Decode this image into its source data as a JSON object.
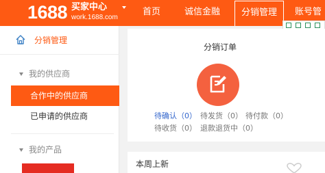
{
  "header": {
    "logo_num": "1688",
    "logo_title": "买家中心",
    "logo_url": "work.1688.com",
    "nav": {
      "home": "首页",
      "credit": "诚信金融",
      "distribution": "分销管理",
      "account": "账号管"
    },
    "accent_color": "#fe5a13"
  },
  "sidebar": {
    "head_label": "分销管理",
    "groups": [
      {
        "title": "我的供应商",
        "items": [
          {
            "label": "合作中的供应商",
            "active": true
          },
          {
            "label": "已申请的供应商",
            "active": false
          }
        ]
      },
      {
        "title": "我的产品",
        "items": []
      }
    ]
  },
  "main": {
    "orders_title": "分销订单",
    "icon": "edit-document-icon",
    "stats": [
      {
        "label": "待确认（0）"
      },
      {
        "label": "待发货（0）"
      },
      {
        "label": "待付款（0）"
      },
      {
        "label": "待收货（0）"
      },
      {
        "label": "退款退货中（0）"
      }
    ],
    "weekly_title": "本周上新"
  }
}
